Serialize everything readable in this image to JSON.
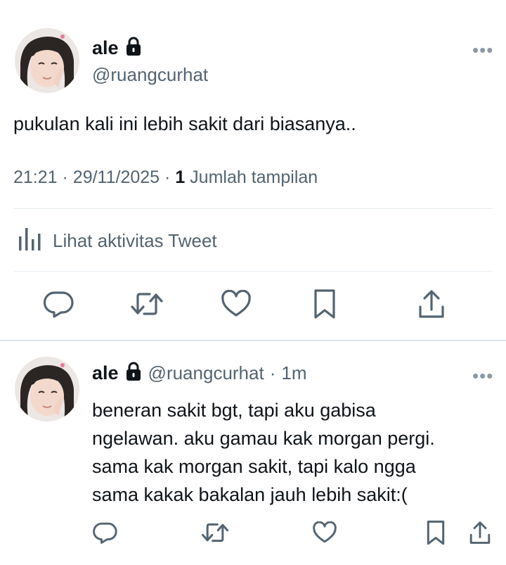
{
  "main_tweet": {
    "author_name": "ale",
    "author_handle": "@ruangcurhat",
    "text": "pukulan kali ini lebih sakit dari biasanya..",
    "time": "21:21",
    "date": "29/11/2025",
    "views_count": "1",
    "views_label": "Jumlah tampilan",
    "activity_label": "Lihat aktivitas Tweet",
    "more": "•••"
  },
  "reply_tweet": {
    "author_name": "ale",
    "author_handle": "@ruangcurhat",
    "age": "1m",
    "lines": [
      "beneran sakit bgt, tapi aku gabisa",
      "ngelawan. aku gamau kak morgan pergi.",
      "sama kak morgan sakit, tapi kalo ngga",
      "sama kakak bakalan jauh lebih sakit:("
    ],
    "more": "•••"
  },
  "separator": "·",
  "icons": {
    "lock": "lock-icon",
    "reply": "reply-icon",
    "retweet": "retweet-icon",
    "like": "heart-icon",
    "bookmark": "bookmark-icon",
    "share": "share-icon",
    "analytics": "analytics-icon"
  },
  "colors": {
    "text": "#0f1419",
    "secondary": "#536471",
    "icon": "#536471",
    "divider": "#e6ecf0"
  }
}
